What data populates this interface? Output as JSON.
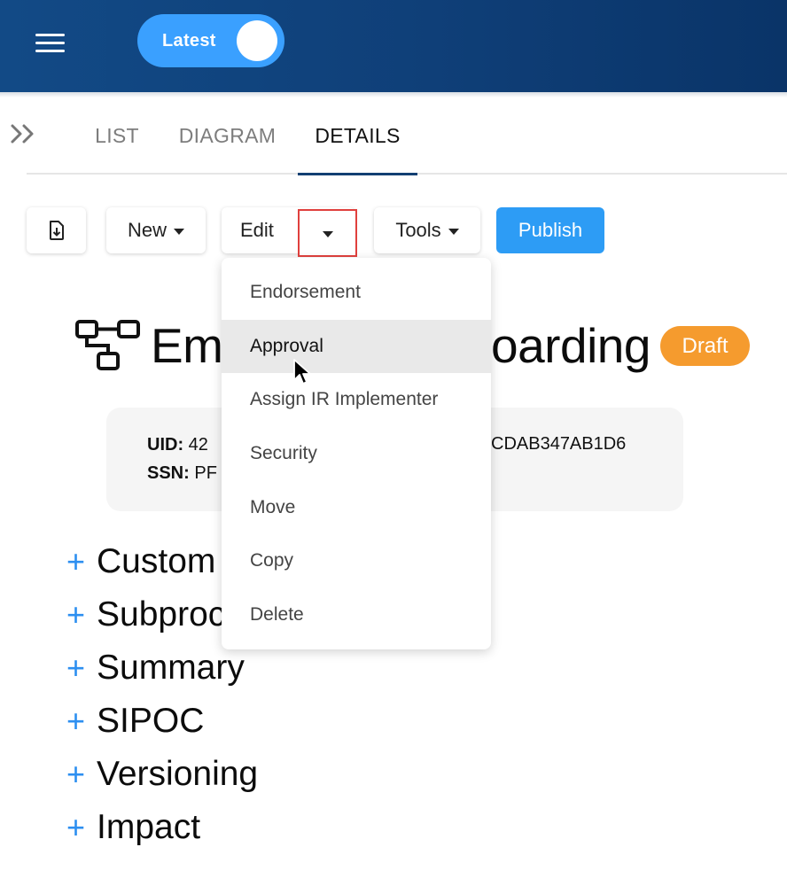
{
  "header": {
    "menu_icon": "hamburger-menu-icon",
    "toggle_label": "Latest",
    "toggle_on": true
  },
  "tabs": {
    "expand_icon": "double-chevron-right-icon",
    "items": [
      {
        "label": "LIST",
        "active": false
      },
      {
        "label": "DIAGRAM",
        "active": false
      },
      {
        "label": "DETAILS",
        "active": true
      }
    ]
  },
  "toolbar": {
    "export_icon": "file-download-icon",
    "new_label": "New",
    "edit_label": "Edit",
    "tools_label": "Tools",
    "publish_label": "Publish",
    "publish_color": "#2d9cf5"
  },
  "process": {
    "icon": "process-flow-icon",
    "title_visible_left": "Em",
    "title_visible_right": "oarding",
    "status_badge": "Draft",
    "badge_color": "#f59b2e"
  },
  "info_card": {
    "uid_label": "UID:",
    "uid_value_visible_start": "42",
    "uid_value_visible_end": "CDAB347AB1D6",
    "ssn_label": "SSN:",
    "ssn_value_visible_start": "PF"
  },
  "sections": [
    {
      "label": "Custom"
    },
    {
      "label": "Subproc"
    },
    {
      "label": "Summary"
    },
    {
      "label": "SIPOC"
    },
    {
      "label": "Versioning"
    },
    {
      "label": "Impact"
    }
  ],
  "edit_dropdown": {
    "items": [
      {
        "label": "Endorsement"
      },
      {
        "label": "Approval",
        "hovered": true
      },
      {
        "label": "Assign IR Implementer"
      },
      {
        "label": "Security"
      },
      {
        "label": "Move"
      },
      {
        "label": "Copy"
      },
      {
        "label": "Delete"
      }
    ]
  },
  "colors": {
    "header_bg": "#124a86",
    "accent_blue": "#2d8ff0",
    "highlight_border": "#e0403d"
  }
}
